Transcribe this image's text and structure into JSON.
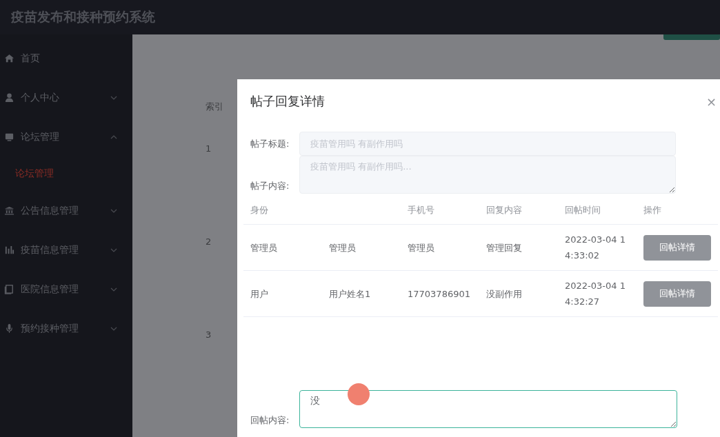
{
  "app": {
    "title": "疫苗发布和接种预约系统"
  },
  "sidebar": {
    "items": [
      {
        "label": "首页"
      },
      {
        "label": "个人中心",
        "expanded": false
      },
      {
        "label": "论坛管理",
        "expanded": true,
        "children": [
          {
            "label": "论坛管理",
            "selected": true
          }
        ]
      },
      {
        "label": "公告信息管理",
        "expanded": false
      },
      {
        "label": "疫苗信息管理",
        "expanded": false
      },
      {
        "label": "医院信息管理",
        "expanded": false
      },
      {
        "label": "预约接种管理",
        "expanded": false
      }
    ]
  },
  "background_table": {
    "header": "索引",
    "rows": [
      "1",
      "2",
      "3"
    ]
  },
  "dialog": {
    "title": "帖子回复详情",
    "close": "×",
    "fields": [
      {
        "label": "帖子标题:",
        "value": "疫苗管用吗 有副作用吗"
      },
      {
        "label": "帖子内容:",
        "value": "疫苗管用吗 有副作用吗..."
      }
    ],
    "table": {
      "columns": [
        "身份",
        "",
        "手机号",
        "回复内容",
        "回帖时间",
        "操作"
      ],
      "rows": [
        {
          "cells": [
            "管理员",
            "管理员",
            "管理员",
            "管理回复",
            "2022-03-04 14:33:02"
          ],
          "action": "回帖详情"
        },
        {
          "cells": [
            "用户",
            "用户姓名1",
            "17703786901",
            "没副作用",
            "2022-03-04 14:32:27"
          ],
          "action": "回帖详情"
        }
      ]
    },
    "reply": {
      "label": "回帖内容:",
      "value": "没"
    }
  }
}
